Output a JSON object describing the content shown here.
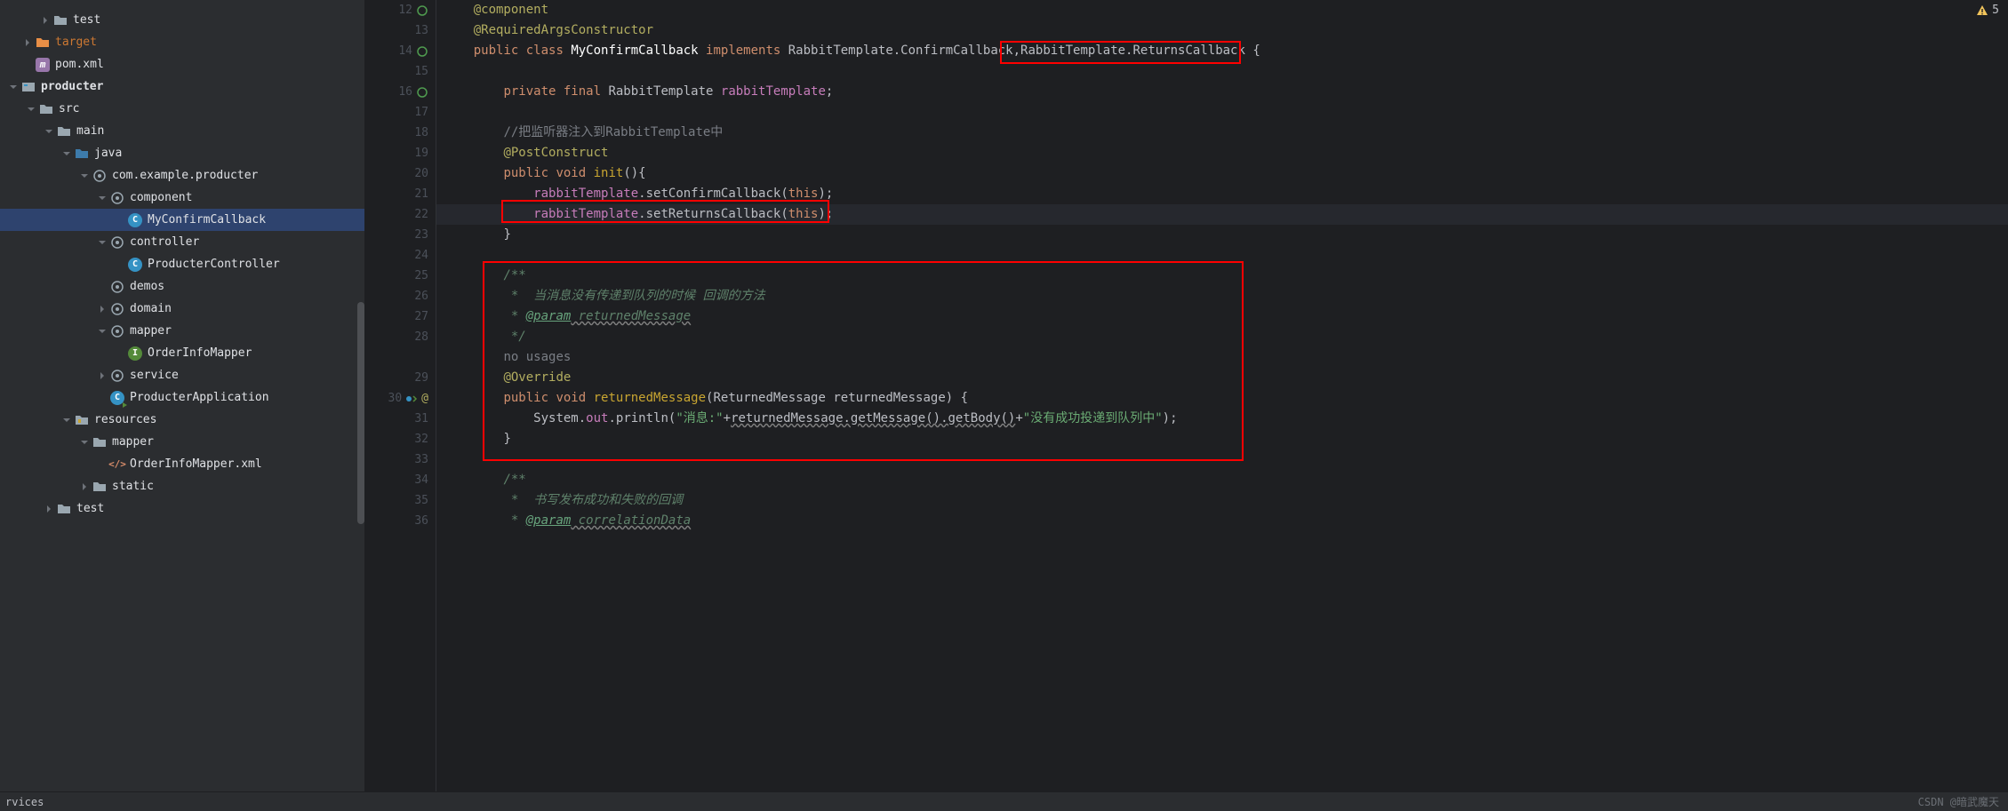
{
  "tree": {
    "test": "test",
    "target": "target",
    "pom": "pom.xml",
    "producter": "producter",
    "src": "src",
    "main": "main",
    "java": "java",
    "pkg": "com.example.producter",
    "component": "component",
    "myConfirm": "MyConfirmCallback",
    "controller": "controller",
    "producterController": "ProducterController",
    "demos": "demos",
    "domain": "domain",
    "mapper": "mapper",
    "orderInfoMapper": "OrderInfoMapper",
    "service": "service",
    "producterApp": "ProducterApplication",
    "resources": "resources",
    "mapper2": "mapper",
    "orderInfoXml": "OrderInfoMapper.xml",
    "static": "static",
    "test2": "test"
  },
  "gutter": {
    "lines": [
      "12",
      "13",
      "14",
      "15",
      "16",
      "17",
      "18",
      "19",
      "20",
      "21",
      "22",
      "23",
      "24",
      "25",
      "26",
      "27",
      "28",
      "",
      "29",
      "30",
      "31",
      "32",
      "33",
      "34",
      "35",
      "36"
    ]
  },
  "code": {
    "l12": "@component",
    "l13": "@RequiredArgsConstructor",
    "l14_pub": "public ",
    "l14_cls": "class ",
    "l14_name": "MyConfirmCallback ",
    "l14_impl": "implements ",
    "l14_t1": "RabbitTemplate.ConfirmCallback,",
    "l14_t2": "RabbitTemplate.ReturnsCallback {",
    "l16_priv": "private ",
    "l16_final": "final ",
    "l16_type": "RabbitTemplate ",
    "l16_name": "rabbitTemplate",
    "l16_end": ";",
    "l18": "//把监听器注入到RabbitTemplate中",
    "l19": "@PostConstruct",
    "l20_pub": "public ",
    "l20_void": "void ",
    "l20_name": "init",
    "l20_end": "(){",
    "l21_f": "rabbitTemplate",
    "l21_m": ".setConfirmCallback(",
    "l21_this": "this",
    "l21_end": ");",
    "l22_f": "rabbitTemplate",
    "l22_m": ".setReturnsCallback(",
    "l22_this": "this",
    "l22_end": ");",
    "l23": "}",
    "l25": "/**",
    "l26": " *  当消息没有传递到队列的时候 回调的方法",
    "l27a": " * ",
    "l27b": "@param",
    "l27c": " returnedMessage",
    "l28": " */",
    "l28n": "no usages",
    "l29": "@Override",
    "l30_pub": "public ",
    "l30_void": "void ",
    "l30_name": "returnedMessage",
    "l30_p": "(ReturnedMessage returnedMessage) {",
    "l31_a": "System.",
    "l31_out": "out",
    "l31_b": ".println(",
    "l31_s1": "\"消息:\"",
    "l31_c": "+",
    "l31_d": "returnedMessage.getMessage().getBody()",
    "l31_e": "+",
    "l31_s2": "\"没有成功投递到队列中\"",
    "l31_f": ");",
    "l32": "}",
    "l34": "/**",
    "l35": " *  书写发布成功和失败的回调",
    "l36a": " * ",
    "l36b": "@param",
    "l36c": " correlationData"
  },
  "warning_count": "5",
  "bottom_label": "rvices",
  "watermark": "CSDN @暗武魔天"
}
